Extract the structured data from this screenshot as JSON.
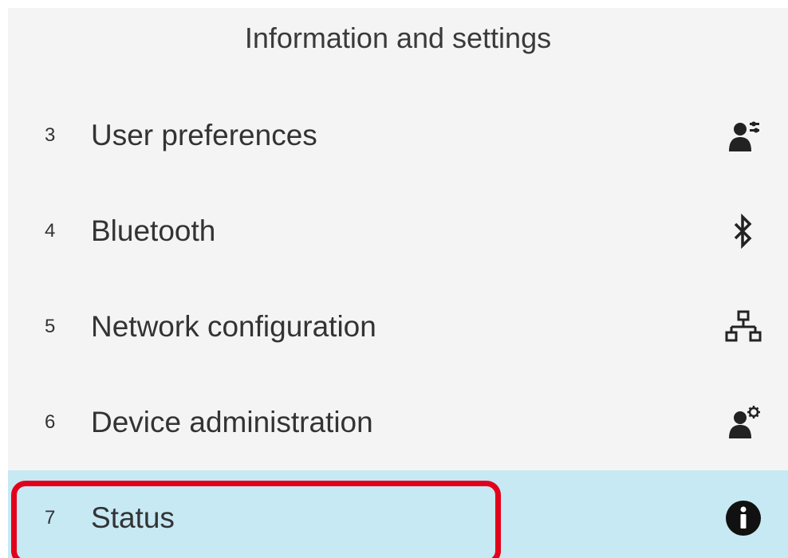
{
  "header": {
    "title": "Information and settings"
  },
  "menu": {
    "items": [
      {
        "number": "3",
        "label": "User preferences",
        "icon": "user-preferences-icon"
      },
      {
        "number": "4",
        "label": "Bluetooth",
        "icon": "bluetooth-icon"
      },
      {
        "number": "5",
        "label": "Network configuration",
        "icon": "network-icon"
      },
      {
        "number": "6",
        "label": "Device administration",
        "icon": "admin-gear-icon"
      },
      {
        "number": "7",
        "label": "Status",
        "icon": "info-icon",
        "selected": true
      }
    ]
  },
  "colors": {
    "selected_row": "#c6e9f4",
    "highlight_box": "#e3001b",
    "background": "#f4f4f4",
    "text": "#333333"
  }
}
